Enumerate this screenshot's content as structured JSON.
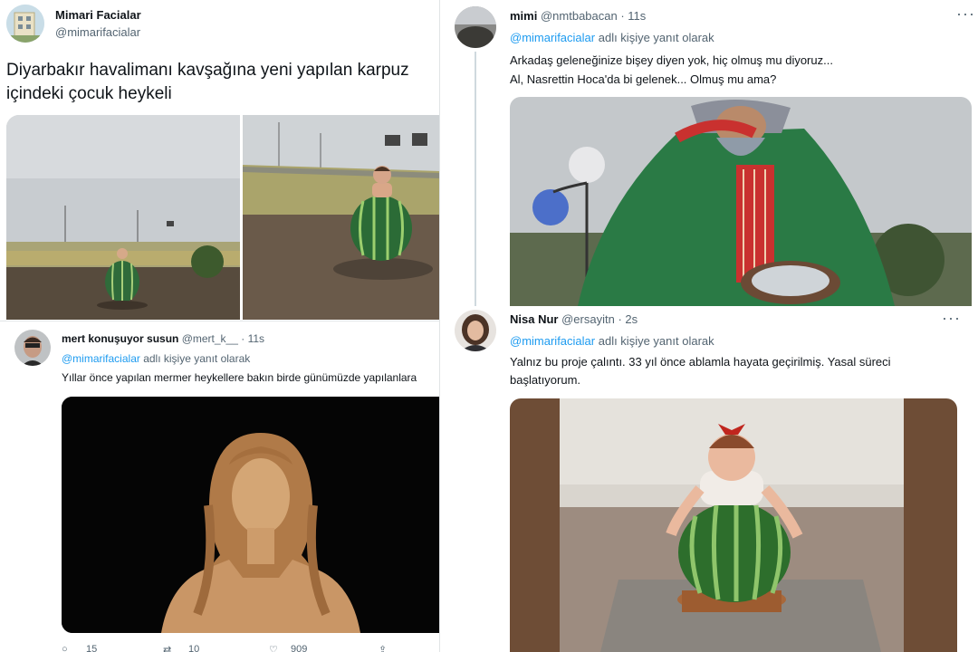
{
  "tweet_main": {
    "display_name": "Mimari Facialar",
    "handle": "@mimarifacialar",
    "text_line1": "Diyarbakır havalimanı kavşağına yeni yapılan karpuz",
    "text_line2": "içindeki çocuk heykeli"
  },
  "reply_mert": {
    "display_name": "mert konuşuyor susun",
    "handle": "@mert_k__",
    "time": "· 11s",
    "reply_to_handle": "@mimarifacialar",
    "reply_to_suffix": "adlı kişiye yanıt olarak",
    "text": "Yıllar önce yapılan mermer heykellere bakın birde günümüzde yapılanlara",
    "actions": {
      "reply_count": "15",
      "retweet_count": "10",
      "like_count": "909"
    }
  },
  "reply_mimi": {
    "display_name": "mimi",
    "handle": "@nmtbabacan",
    "time": "· 11s",
    "reply_to_handle": "@mimarifacialar",
    "reply_to_suffix": "adlı kişiye yanıt olarak",
    "text_line1": "Arkadaş geleneğinize bişey diyen yok, hiç olmuş mu diyoruz...",
    "text_line2": "Al, Nasrettin Hoca'da bi gelenek... Olmuş mu ama?"
  },
  "reply_nisa": {
    "display_name": "Nisa Nur",
    "handle": "@ersayitn",
    "time": "· 2s",
    "reply_to_handle": "@mimarifacialar",
    "reply_to_suffix": "adlı kişiye yanıt olarak",
    "text_line1": "Yalnız bu proje çalıntı. 33 yıl önce ablamla hayata geçirilmiş. Yasal süreci",
    "text_line2": "başlatıyorum."
  },
  "icons": {
    "more": "more-horizontal-icon",
    "reply": "reply-icon",
    "retweet": "retweet-icon",
    "like": "heart-icon",
    "share": "share-icon"
  },
  "colors": {
    "link": "#1d9bf0",
    "muted": "#536471",
    "thread_line": "#cfd9de"
  }
}
